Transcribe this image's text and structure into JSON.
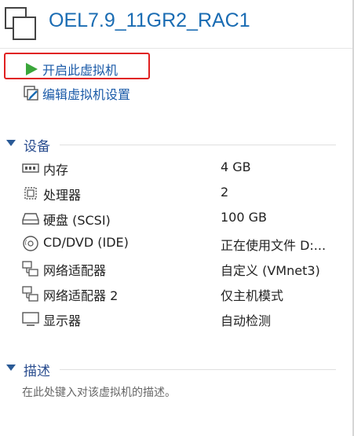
{
  "window": {
    "title": "OEL7.9_11GR2_RAC1",
    "icon": "vm-window-icon"
  },
  "actions": [
    {
      "label": "开启此虚拟机",
      "icon": "play-icon",
      "color": "#3aa63a"
    },
    {
      "label": "编辑虚拟机设置",
      "icon": "edit-settings-icon"
    }
  ],
  "devices_section": {
    "title": "设备",
    "items": [
      {
        "name": "内存",
        "value": "4 GB",
        "icon": "memory-icon"
      },
      {
        "name": "处理器",
        "value": "2",
        "icon": "cpu-icon"
      },
      {
        "name": "硬盘 (SCSI)",
        "value": "100 GB",
        "icon": "hard-disk-icon"
      },
      {
        "name": "CD/DVD (IDE)",
        "value": "正在使用文件 D:...",
        "icon": "cd-dvd-icon"
      },
      {
        "name": "网络适配器",
        "value": "自定义 (VMnet3)",
        "icon": "network-adapter-icon"
      },
      {
        "name": "网络适配器 2",
        "value": "仅主机模式",
        "icon": "network-adapter-icon"
      },
      {
        "name": "显示器",
        "value": "自动检测",
        "icon": "display-icon"
      }
    ]
  },
  "description_section": {
    "title": "描述",
    "placeholder": "在此处键入对该虚拟机的描述。"
  },
  "colors": {
    "title_blue": "#1a6cb3",
    "link_blue": "#1a5aa8",
    "highlight_red": "#e02020",
    "play_green": "#3aa63a"
  }
}
